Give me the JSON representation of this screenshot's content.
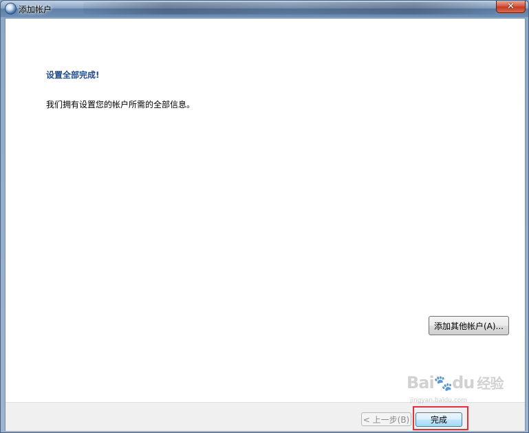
{
  "window": {
    "title": "添加帐户",
    "close_symbol": "✕"
  },
  "content": {
    "heading": "设置全部完成!",
    "message": "我们拥有设置您的帐户所需的全部信息。",
    "add_other_button": "添加其他帐户(A)..."
  },
  "footer": {
    "back_button": "< 上一步(B)",
    "finish_button": "完成"
  },
  "watermark": {
    "brand_a": "Bai",
    "brand_b": "du",
    "brand_cn": "经验",
    "url": "jingyan.baidu.com"
  },
  "colors": {
    "heading": "#1f4a8a",
    "highlight": "#e0303a",
    "finish_border": "#3c7fb1"
  },
  "icons": {
    "app": "globe-icon",
    "close": "close-icon",
    "watermark": "paw-icon"
  }
}
